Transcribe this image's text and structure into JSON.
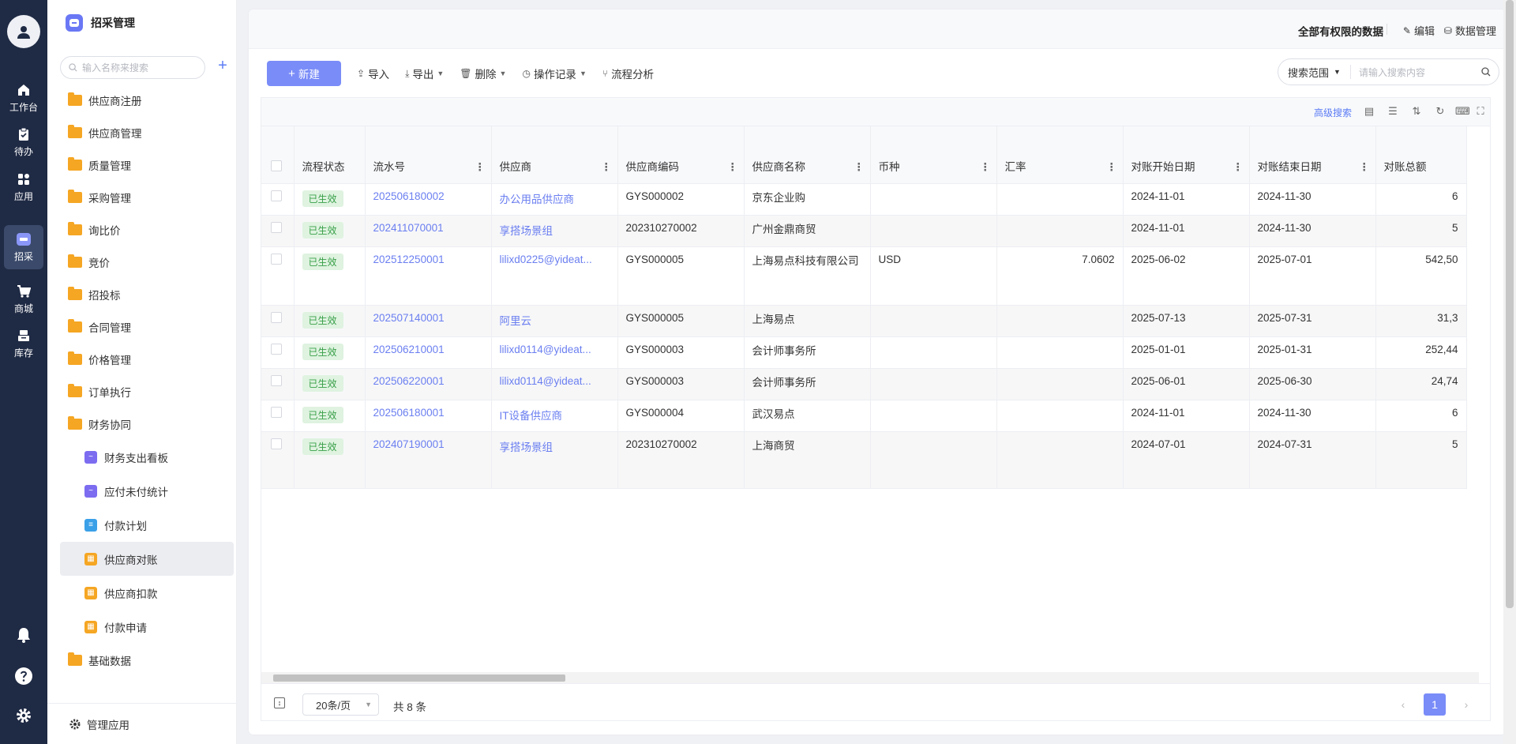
{
  "rail": {
    "items": [
      {
        "label": "工作台",
        "icon": "home-icon"
      },
      {
        "label": "待办",
        "icon": "clipboard-check-icon"
      },
      {
        "label": "应用",
        "icon": "grid-apps-icon"
      },
      {
        "label": "招采",
        "icon": "procurement-icon"
      },
      {
        "label": "商城",
        "icon": "cart-icon"
      },
      {
        "label": "库存",
        "icon": "inventory-icon"
      }
    ]
  },
  "sidebar": {
    "app_title": "招采管理",
    "search_placeholder": "输入名称来搜索",
    "add_symbol": "+",
    "items": [
      {
        "label": "供应商注册"
      },
      {
        "label": "供应商管理"
      },
      {
        "label": "质量管理"
      },
      {
        "label": "采购管理"
      },
      {
        "label": "询比价"
      },
      {
        "label": "竞价"
      },
      {
        "label": "招投标"
      },
      {
        "label": "合同管理"
      },
      {
        "label": "价格管理"
      },
      {
        "label": "订单执行"
      },
      {
        "label": "财务协同"
      }
    ],
    "sub_items": [
      {
        "label": "财务支出看板",
        "color": "#7b6cf0"
      },
      {
        "label": "应付未付统计",
        "color": "#7b6cf0"
      },
      {
        "label": "付款计划",
        "color": "#3aa0e8"
      },
      {
        "label": "供应商对账",
        "color": "#f5a623"
      },
      {
        "label": "供应商扣款",
        "color": "#f5a623"
      },
      {
        "label": "付款申请",
        "color": "#f5a623"
      }
    ],
    "last_item": "基础数据",
    "footer_label": "管理应用"
  },
  "header": {
    "permission": "全部有权限的数据",
    "edit": "编辑",
    "data_manage": "数据管理"
  },
  "toolbar": {
    "new": "新建",
    "import": "导入",
    "export": "导出",
    "delete": "删除",
    "op_log": "操作记录",
    "flow_analysis": "流程分析",
    "search_scope": "搜索范围",
    "search_placeholder": "请输入搜索内容",
    "advanced_search": "高级搜索"
  },
  "table": {
    "columns": [
      "流程状态",
      "流水号",
      "供应商",
      "供应商编码",
      "供应商名称",
      "币种",
      "汇率",
      "对账开始日期",
      "对账结束日期",
      "对账总额"
    ],
    "rows": [
      {
        "status": "已生效",
        "serial": "202506180002",
        "supplier": "办公用品供应商",
        "code": "GYS000002",
        "name": "京东企业购",
        "currency": "",
        "rate": "",
        "start": "2024-11-01",
        "end": "2024-11-30",
        "total": "6"
      },
      {
        "status": "已生效",
        "serial": "202411070001",
        "supplier": "享搭场景组",
        "code": "202310270002",
        "name": "广州金鼎商贸",
        "currency": "",
        "rate": "",
        "start": "2024-11-01",
        "end": "2024-11-30",
        "total": "5"
      },
      {
        "status": "已生效",
        "serial": "202512250001",
        "supplier": "lilixd0225@yideat...",
        "code": "GYS000005",
        "name": "上海易点科技有限公司",
        "currency": "USD",
        "rate": "7.0602",
        "start": "2025-06-02",
        "end": "2025-07-01",
        "total": "542,50"
      },
      {
        "status": "已生效",
        "serial": "202507140001",
        "supplier": "阿里云",
        "code": "GYS000005",
        "name": "上海易点",
        "currency": "",
        "rate": "",
        "start": "2025-07-13",
        "end": "2025-07-31",
        "total": "31,3"
      },
      {
        "status": "已生效",
        "serial": "202506210001",
        "supplier": "lilixd0114@yideat...",
        "code": "GYS000003",
        "name": "会计师事务所",
        "currency": "",
        "rate": "",
        "start": "2025-01-01",
        "end": "2025-01-31",
        "total": "252,44"
      },
      {
        "status": "已生效",
        "serial": "202506220001",
        "supplier": "lilixd0114@yideat...",
        "code": "GYS000003",
        "name": "会计师事务所",
        "currency": "",
        "rate": "",
        "start": "2025-06-01",
        "end": "2025-06-30",
        "total": "24,74"
      },
      {
        "status": "已生效",
        "serial": "202506180001",
        "supplier": "IT设备供应商",
        "code": "GYS000004",
        "name": "武汉易点",
        "currency": "",
        "rate": "",
        "start": "2024-11-01",
        "end": "2024-11-30",
        "total": "6"
      },
      {
        "status": "已生效",
        "serial": "202407190001",
        "supplier": "享搭场景组",
        "code": "202310270002",
        "name": "上海商贸",
        "currency": "",
        "rate": "",
        "start": "2024-07-01",
        "end": "2024-07-31",
        "total": "5"
      }
    ]
  },
  "pagination": {
    "page_size": "20条/页",
    "total": "共 8 条",
    "current": "1"
  },
  "colors": {
    "accent": "#7a8cf8",
    "rail_bg": "#1f2a44",
    "status_bg": "#dff3e0",
    "status_text": "#3aa04a"
  }
}
